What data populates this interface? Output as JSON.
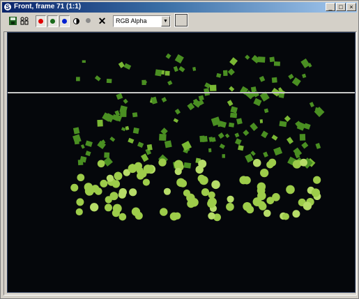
{
  "window": {
    "title": "Front, frame 71 (1:1)",
    "controls": {
      "minimize": "_",
      "restore": "□",
      "close": "×"
    }
  },
  "toolbar": {
    "save_icon": "floppy-disk-icon",
    "clone_icon": "clone-icon",
    "channels": [
      {
        "name": "red-channel",
        "color": "#e00000"
      },
      {
        "name": "green-channel",
        "color": "#1a6a1a"
      },
      {
        "name": "blue-channel",
        "color": "#0020d0"
      },
      {
        "name": "alpha-channel",
        "color": "#000000"
      },
      {
        "name": "mono-channel",
        "color": "#8a8a8a"
      }
    ],
    "clear_label": "✕",
    "channel_select_value": "RGB Alpha"
  },
  "viewport": {
    "background": "#05070b",
    "line_color": "#c8c8c8",
    "falling_color": "#4a8f22",
    "ball_color": "#9dcc4a"
  }
}
